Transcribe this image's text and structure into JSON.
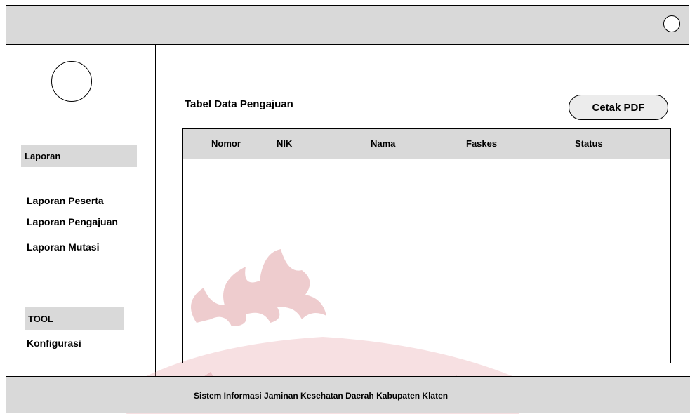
{
  "sidebar": {
    "laporan_header": "Laporan",
    "items": [
      {
        "label": "Laporan Peserta"
      },
      {
        "label": "Laporan Pengajuan"
      },
      {
        "label": "Laporan Mutasi"
      }
    ],
    "tool_header": "TOOL",
    "tool_items": [
      {
        "label": "Konfigurasi"
      }
    ]
  },
  "main": {
    "title": "Tabel Data Pengajuan",
    "print_button": "Cetak PDF",
    "table": {
      "columns": [
        "Nomor",
        "NIK",
        "Nama",
        "Faskes",
        "Status"
      ],
      "rows": []
    }
  },
  "footer": {
    "text": "Sistem Informasi Jaminan Kesehatan Daerah Kabupaten Klaten"
  },
  "colors": {
    "panel_gray": "#d9d9d9",
    "watermark_red": "#c8102e"
  },
  "icons": {
    "top_right": "circle-icon",
    "avatar": "avatar-placeholder-icon"
  }
}
